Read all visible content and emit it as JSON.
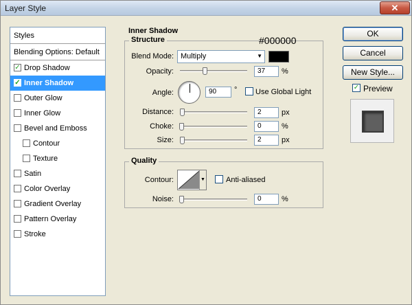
{
  "window": {
    "title": "Layer Style",
    "close_symbol": "✕"
  },
  "sidebar": {
    "header": "Styles",
    "blending": "Blending Options: Default",
    "items": [
      {
        "label": "Drop Shadow",
        "checked": true,
        "selected": false,
        "sub": false
      },
      {
        "label": "Inner Shadow",
        "checked": true,
        "selected": true,
        "sub": false
      },
      {
        "label": "Outer Glow",
        "checked": false,
        "selected": false,
        "sub": false
      },
      {
        "label": "Inner Glow",
        "checked": false,
        "selected": false,
        "sub": false
      },
      {
        "label": "Bevel and Emboss",
        "checked": false,
        "selected": false,
        "sub": false
      },
      {
        "label": "Contour",
        "checked": false,
        "selected": false,
        "sub": true
      },
      {
        "label": "Texture",
        "checked": false,
        "selected": false,
        "sub": true
      },
      {
        "label": "Satin",
        "checked": false,
        "selected": false,
        "sub": false
      },
      {
        "label": "Color Overlay",
        "checked": false,
        "selected": false,
        "sub": false
      },
      {
        "label": "Gradient Overlay",
        "checked": false,
        "selected": false,
        "sub": false
      },
      {
        "label": "Pattern Overlay",
        "checked": false,
        "selected": false,
        "sub": false
      },
      {
        "label": "Stroke",
        "checked": false,
        "selected": false,
        "sub": false
      }
    ]
  },
  "inner_shadow": {
    "title": "Inner Shadow",
    "structure": {
      "title": "Structure",
      "color_hex": "#000000",
      "blend_mode_label": "Blend Mode:",
      "blend_mode": "Multiply",
      "opacity_label": "Opacity:",
      "opacity": "37",
      "opacity_unit": "%",
      "angle_label": "Angle:",
      "angle": "90",
      "angle_unit": "°",
      "global_light_label": "Use Global Light",
      "distance_label": "Distance:",
      "distance": "2",
      "distance_unit": "px",
      "choke_label": "Choke:",
      "choke": "0",
      "choke_unit": "%",
      "size_label": "Size:",
      "size": "2",
      "size_unit": "px"
    },
    "quality": {
      "title": "Quality",
      "contour_label": "Contour:",
      "anti_aliased_label": "Anti-aliased",
      "noise_label": "Noise:",
      "noise": "0",
      "noise_unit": "%"
    }
  },
  "buttons": {
    "ok": "OK",
    "cancel": "Cancel",
    "new_style": "New Style...",
    "preview": "Preview"
  },
  "checkmark": "✓",
  "colors": {
    "shadow_color": "#000000",
    "selection": "#3399ff"
  }
}
